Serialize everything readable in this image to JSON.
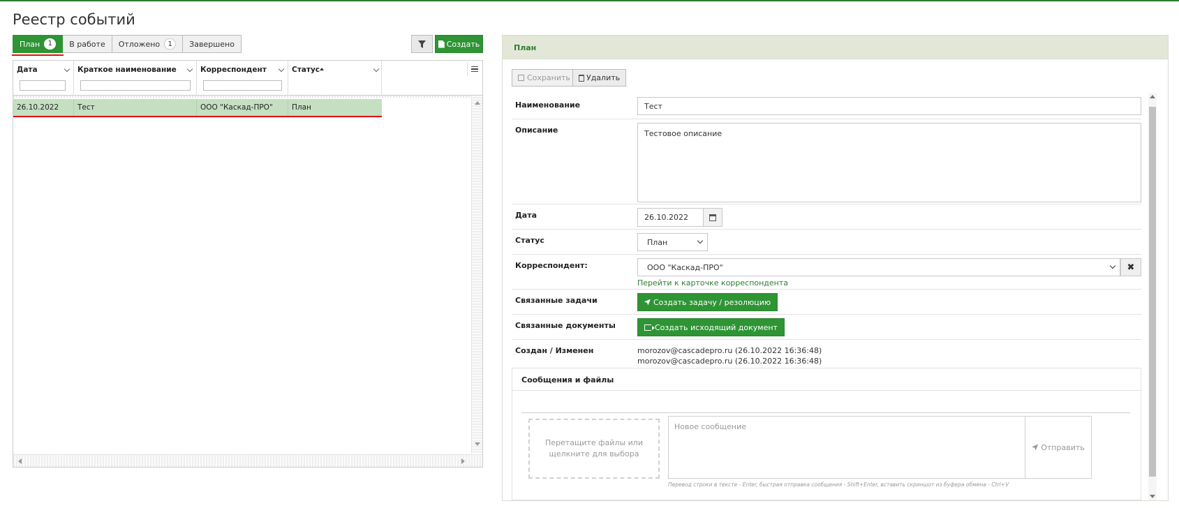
{
  "page_title": "Реестр событий",
  "tabs": [
    {
      "label": "План",
      "badge": "1"
    },
    {
      "label": "В работе",
      "badge": ""
    },
    {
      "label": "Отложено",
      "badge": "1"
    },
    {
      "label": "Завершено",
      "badge": ""
    }
  ],
  "toolbar": {
    "create_label": "Создать",
    "filter_icon": "filter-icon"
  },
  "grid": {
    "columns": [
      "Дата",
      "Краткое наименование",
      "Корреспондент",
      "Статус"
    ],
    "rows": [
      {
        "date": "26.10.2022",
        "name": "Тест",
        "correspondent": "ООО \"Каскад-ПРО\"",
        "status": "План"
      }
    ]
  },
  "panel": {
    "title": "План",
    "save_label": "Сохранить",
    "delete_label": "Удалить",
    "labels": {
      "name": "Наименование",
      "description": "Описание",
      "date": "Дата",
      "status": "Статус",
      "correspondent": "Корреспондент:",
      "related_tasks": "Связанные задачи",
      "related_docs": "Связанные документы",
      "created": "Создан / Изменен"
    },
    "values": {
      "name": "Тест",
      "description": "Тестовое описание",
      "date": "26.10.2022",
      "status": "План",
      "correspondent": "ООО \"Каскад-ПРО\"",
      "correspondent_link": "Перейти к карточке корреспондента",
      "create_task": "Создать задачу / резолюцию",
      "create_doc": "Создать исходящий документ",
      "created_line": "morozov@cascadepro.ru (26.10.2022 16:36:48)",
      "modified_line": "morozov@cascadepro.ru (26.10.2022 16:36:48)"
    },
    "messages": {
      "title": "Сообщения и файлы",
      "drop_text": "Перетащите файлы или щелкните для выбора",
      "placeholder": "Новое сообщение",
      "send_label": "Отправить",
      "hint": "Перевод строки в тексте - Enter, быстрая отправка сообщения - Shift+Enter, вставить скриншот из буфера обмена - Ctrl+V"
    }
  },
  "colors": {
    "accent": "#2e9434",
    "selected_row": "#c5dfc1",
    "panel_header": "#e3e7d8",
    "marker": "#e01010"
  }
}
